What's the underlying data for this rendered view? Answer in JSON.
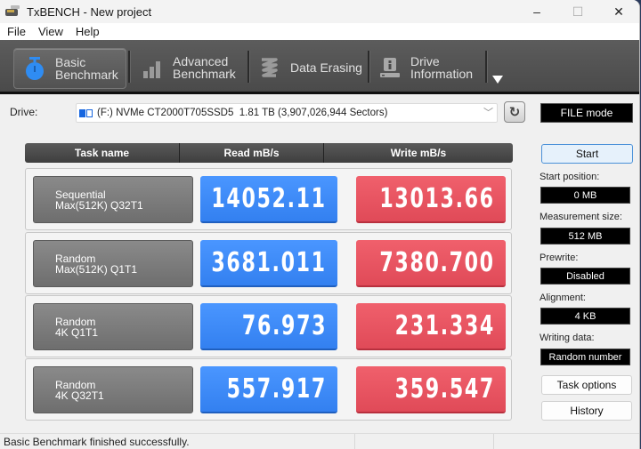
{
  "window": {
    "title": "TxBENCH - New project",
    "controls": {
      "minimize": "–",
      "maximize": "☐",
      "close": "✕"
    }
  },
  "menu": [
    "File",
    "View",
    "Help"
  ],
  "toolbar": {
    "tabs": [
      {
        "label": "Basic\nBenchmark",
        "icon": "stopwatch-icon",
        "active": true
      },
      {
        "label": "Advanced\nBenchmark",
        "icon": "bar-chart-icon",
        "active": false
      },
      {
        "label": "Data Erasing",
        "icon": "erase-icon",
        "active": false
      },
      {
        "label": "Drive\nInformation",
        "icon": "drive-info-icon",
        "active": false
      }
    ]
  },
  "drive": {
    "label": "Drive:",
    "selected": "(F:) NVMe CT2000T705SSD5  1.81 TB (3,907,026,944 Sectors)",
    "mode": "FILE mode"
  },
  "results": {
    "headers": [
      "Task name",
      "Read mB/s",
      "Write mB/s"
    ],
    "rows": [
      {
        "task": "Sequential\nMax(512K) Q32T1",
        "read": "14052.11",
        "write": "13013.66"
      },
      {
        "task": "Random\nMax(512K) Q1T1",
        "read": "3681.011",
        "write": "7380.700"
      },
      {
        "task": "Random\n4K Q1T1",
        "read": "76.973",
        "write": "231.334"
      },
      {
        "task": "Random\n4K Q32T1",
        "read": "557.917",
        "write": "359.547"
      }
    ]
  },
  "panel": {
    "start_label": "Start",
    "start_position_label": "Start position:",
    "start_position_value": "0 MB",
    "measurement_size_label": "Measurement size:",
    "measurement_size_value": "512 MB",
    "prewrite_label": "Prewrite:",
    "prewrite_value": "Disabled",
    "alignment_label": "Alignment:",
    "alignment_value": "4 KB",
    "writing_data_label": "Writing data:",
    "writing_data_value": "Random number",
    "task_options_label": "Task options",
    "history_label": "History"
  },
  "status": {
    "message": "Basic Benchmark finished successfully."
  },
  "colors": {
    "read": "#3a88f7",
    "write": "#e9545f",
    "accent": "#1e7ef0"
  }
}
